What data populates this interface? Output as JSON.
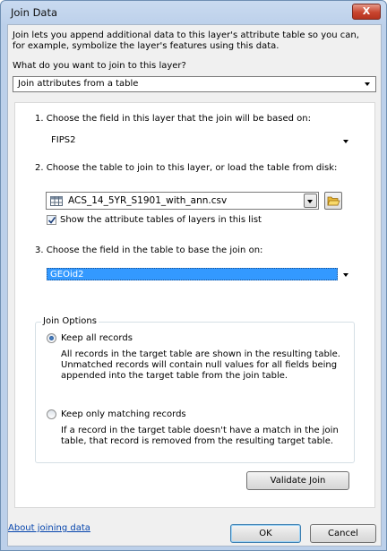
{
  "window": {
    "title": "Join Data",
    "close_label": "X"
  },
  "intro": {
    "line1": "Join lets you append additional data to this layer's attribute table so you can,",
    "line2": "for example, symbolize the layer's features using this data."
  },
  "join_what": {
    "label": "What do you want to join to this layer?",
    "value": "Join attributes from a table"
  },
  "step1": {
    "label": "1.  Choose the field in this layer that the join will be based on:",
    "value": "FIPS2"
  },
  "step2": {
    "label": "2.  Choose the table to join to this layer, or load the table from disk:",
    "value": "ACS_14_5YR_S1901_with_ann.csv",
    "checkbox_label": "Show the attribute tables of layers in this list",
    "checkbox_checked": true
  },
  "step3": {
    "label": "3.  Choose the field in the table to base the join on:",
    "value": "GEOid2"
  },
  "join_options": {
    "title": "Join Options",
    "keep_all": {
      "label": "Keep all records",
      "selected": true,
      "desc1": "All records in the target table are shown in the resulting table.",
      "desc2": "Unmatched records will contain null values for all fields being",
      "desc3": "appended into the target table from the join table."
    },
    "keep_matching": {
      "label": "Keep only matching records",
      "selected": false,
      "desc1": "If a record in the target table doesn't have a match in the join",
      "desc2": "table, that record is removed from the resulting target table."
    }
  },
  "validate_label": "Validate Join",
  "footer": {
    "about_link": "About joining data",
    "ok_label": "OK",
    "cancel_label": "Cancel"
  },
  "colors": {
    "selection": "#3399ff",
    "link": "#0645ad",
    "close": "#c8452f"
  },
  "icons": [
    "close-icon",
    "dropdown-arrow-icon",
    "table-icon",
    "open-folder-icon",
    "checkmark-icon"
  ]
}
